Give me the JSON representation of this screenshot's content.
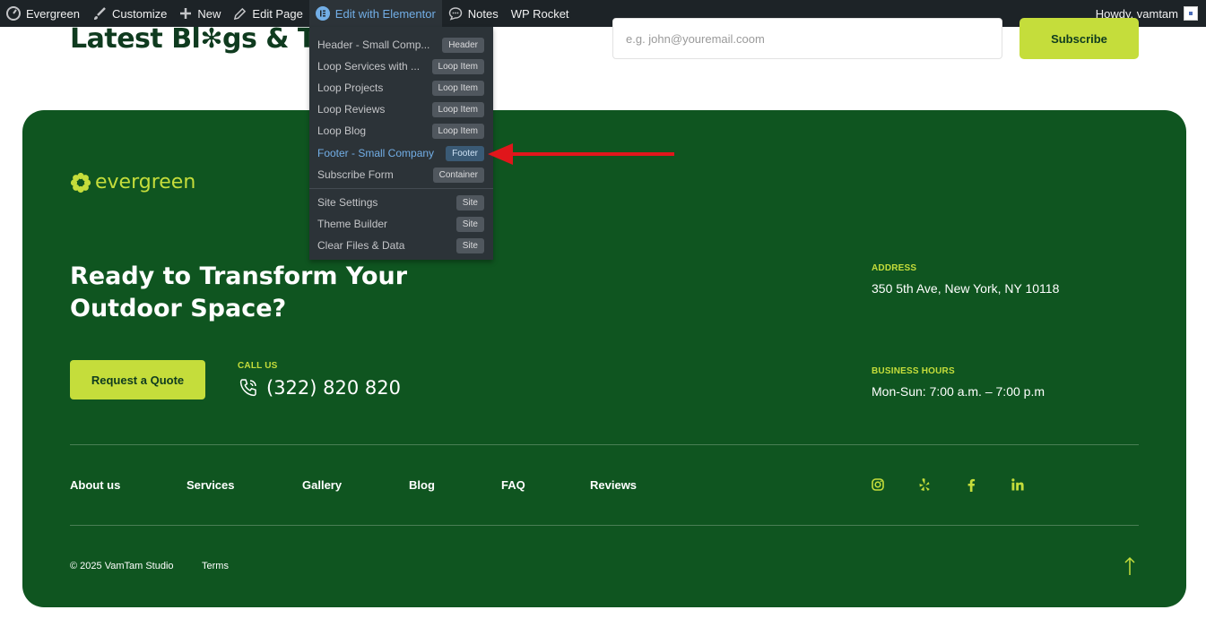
{
  "adminbar": {
    "site_name": "Evergreen",
    "customize": "Customize",
    "new": "New",
    "edit_page": "Edit Page",
    "edit_elementor": "Edit with Elementor",
    "notes": "Notes",
    "wp_rocket": "WP Rocket",
    "howdy": "Howdy, vamtam"
  },
  "dropdown": {
    "items": [
      {
        "label": "Header - Small Comp...",
        "badge": "Header"
      },
      {
        "label": "Loop Services with ...",
        "badge": "Loop Item"
      },
      {
        "label": "Loop Projects",
        "badge": "Loop Item"
      },
      {
        "label": "Loop Reviews",
        "badge": "Loop Item"
      },
      {
        "label": "Loop Blog",
        "badge": "Loop Item"
      },
      {
        "label": "Footer - Small Company",
        "badge": "Footer"
      },
      {
        "label": "Subscribe Form",
        "badge": "Container"
      },
      {
        "label": "Site Settings",
        "badge": "Site"
      },
      {
        "label": "Theme Builder",
        "badge": "Site"
      },
      {
        "label": "Clear Files & Data",
        "badge": "Site"
      }
    ]
  },
  "top": {
    "blogs_heading": "Latest Bl✻gs & Tips",
    "email_placeholder": "e.g. john@youremail.coom",
    "subscribe": "Subscribe"
  },
  "footer": {
    "logo_text": "evergreen",
    "cta_heading": "Ready to Transform Your Outdoor Space?",
    "quote_button": "Request a Quote",
    "call_label": "CALL US",
    "phone": "(322) 820 820",
    "address_label": "ADDRESS",
    "address": "350 5th Ave, New York, NY 10118",
    "hours_label": "BUSINESS HOURS",
    "hours": "Mon-Sun: 7:00 a.m. – 7:00 p.m",
    "nav": [
      "About us",
      "Services",
      "Gallery",
      "Blog",
      "FAQ",
      "Reviews"
    ],
    "socials": [
      "instagram-icon",
      "yelp-icon",
      "facebook-icon",
      "linkedin-icon"
    ],
    "copyright": "© 2025 VamTam Studio",
    "terms": "Terms"
  },
  "colors": {
    "footer_bg": "#0f5520",
    "accent": "#c5dd3b",
    "adminbar_bg": "#1d2327",
    "arrow": "#e0161b"
  }
}
